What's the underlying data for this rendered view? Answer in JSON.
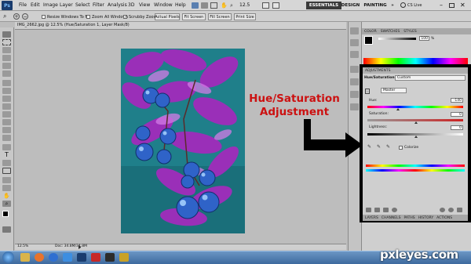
{
  "app": {
    "logo": "Ps"
  },
  "menu": [
    "File",
    "Edit",
    "Image",
    "Layer",
    "Select",
    "Filter",
    "Analysis",
    "3D",
    "View",
    "Window",
    "Help"
  ],
  "zoom_level": "12.5",
  "workspaces": [
    "ESSENTIALS",
    "DESIGN",
    "PAINTING"
  ],
  "more_label": "»",
  "cs_live": "CS Live",
  "options": {
    "resize_windows": "Resize Windows To Fit",
    "zoom_all": "Zoom All Windows",
    "scrubby": "Scrubby Zoom",
    "actual_pixels": "Actual Pixels",
    "fit_screen": "Fit Screen",
    "fill_screen": "Fill Screen",
    "print_size": "Print Size"
  },
  "document": {
    "tab_title": "IMG_2662.jpg @ 12.5% (Hue/Saturation 1, Layer Mask/8)",
    "status_zoom": "12.5%",
    "status_doc": "Doc: 34.8M/34.8M"
  },
  "color_panel": {
    "tabs": [
      "COLOR",
      "SWATCHES",
      "STYLES"
    ],
    "k_value": "100",
    "k_pct": "%"
  },
  "adjustments": {
    "tab": "ADJUSTMENTS",
    "title": "Hue/Saturation",
    "preset": "Custom",
    "channel": "Master",
    "hue_label": "Hue:",
    "hue_value": "-140",
    "saturation_label": "Saturation:",
    "saturation_value": "0",
    "lightness_label": "Lightness:",
    "lightness_value": "0",
    "colorize_label": "Colorize"
  },
  "bottom_tabs": [
    "LAYERS",
    "CHANNELS",
    "PATHS",
    "HISTORY",
    "ACTIONS"
  ],
  "annotation": {
    "line1": "Hue/Saturation",
    "line2": "Adjustment"
  },
  "watermark": "pxleyes.com"
}
